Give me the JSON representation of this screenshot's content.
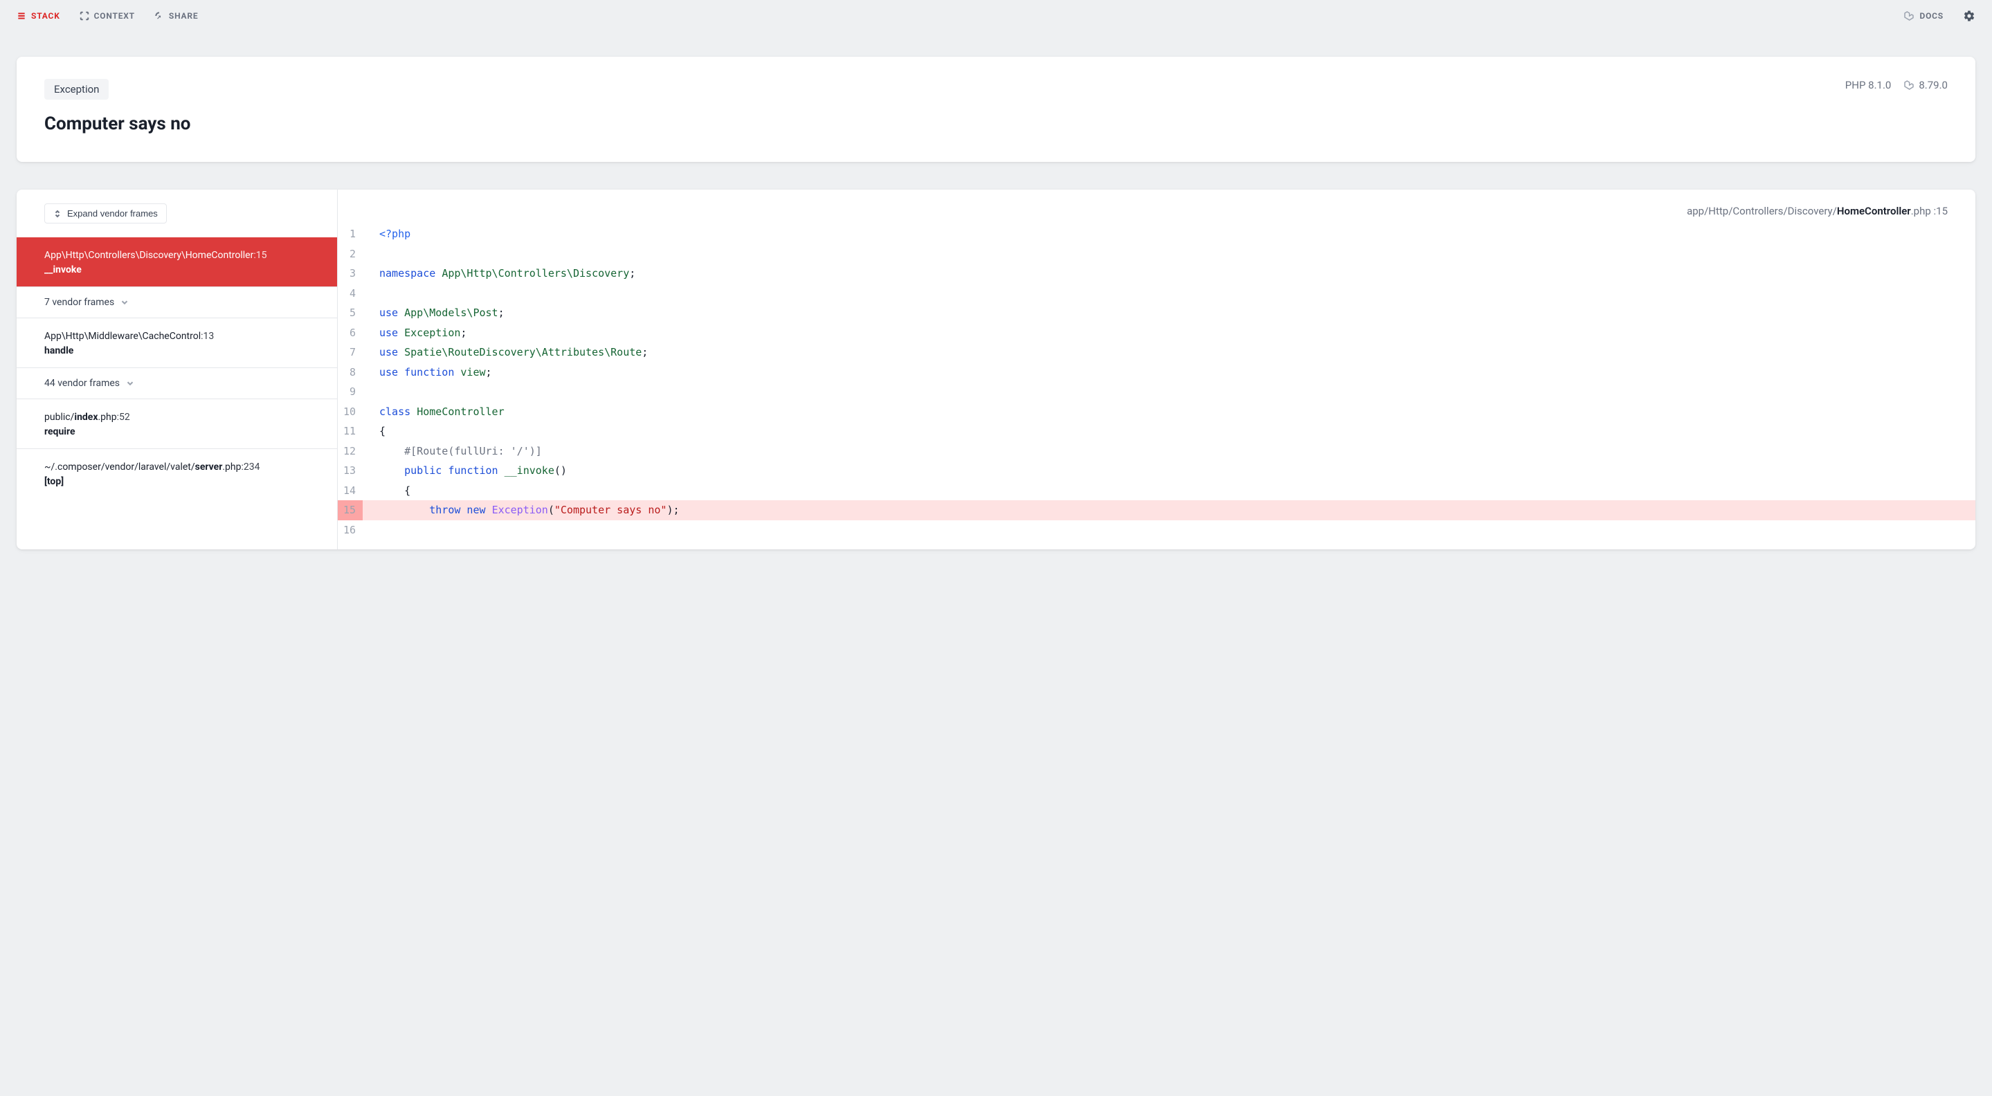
{
  "nav": {
    "stack": "STACK",
    "context": "CONTEXT",
    "share": "SHARE",
    "docs": "DOCS"
  },
  "header": {
    "badge": "Exception",
    "title": "Computer says no",
    "php_version": "PHP 8.1.0",
    "framework_version": "8.79.0"
  },
  "sidebar": {
    "expand_label": "Expand vendor frames",
    "frames": [
      {
        "type": "active",
        "path": "App\\Http\\Controllers\\Discovery\\HomeController",
        "line": "15",
        "method": "__invoke"
      },
      {
        "type": "collapsed",
        "label": "7 vendor frames"
      },
      {
        "type": "frame",
        "path": "App\\Http\\Middleware\\CacheControl",
        "line": "13",
        "method": "handle"
      },
      {
        "type": "collapsed",
        "label": "44 vendor frames"
      },
      {
        "type": "frame",
        "path_pre": "public/",
        "path_bold": "index",
        "path_post": ".php",
        "line": "52",
        "method": "require"
      },
      {
        "type": "frame",
        "path_pre": "~/.composer/vendor/laravel/valet/",
        "path_bold": "server",
        "path_post": ".php",
        "line": "234",
        "method": "[top]"
      }
    ]
  },
  "file": {
    "segments": [
      "app",
      "Http",
      "Controllers",
      "Discovery"
    ],
    "name": "HomeController",
    "ext": ".php",
    "line": "15"
  },
  "code": {
    "highlight": 15,
    "lines": [
      {
        "n": 1,
        "tokens": [
          [
            "tag",
            "<?php"
          ]
        ]
      },
      {
        "n": 2,
        "tokens": []
      },
      {
        "n": 3,
        "tokens": [
          [
            "kw",
            "namespace "
          ],
          [
            "ns",
            "App\\Http\\Controllers\\Discovery"
          ],
          [
            "plain",
            ";"
          ]
        ]
      },
      {
        "n": 4,
        "tokens": []
      },
      {
        "n": 5,
        "tokens": [
          [
            "kw",
            "use "
          ],
          [
            "ns",
            "App\\Models\\Post"
          ],
          [
            "plain",
            ";"
          ]
        ]
      },
      {
        "n": 6,
        "tokens": [
          [
            "kw",
            "use "
          ],
          [
            "ns",
            "Exception"
          ],
          [
            "plain",
            ";"
          ]
        ]
      },
      {
        "n": 7,
        "tokens": [
          [
            "kw",
            "use "
          ],
          [
            "ns",
            "Spatie\\RouteDiscovery\\Attributes\\Route"
          ],
          [
            "plain",
            ";"
          ]
        ]
      },
      {
        "n": 8,
        "tokens": [
          [
            "kw",
            "use function "
          ],
          [
            "ns",
            "view"
          ],
          [
            "plain",
            ";"
          ]
        ]
      },
      {
        "n": 9,
        "tokens": []
      },
      {
        "n": 10,
        "tokens": [
          [
            "kw",
            "class "
          ],
          [
            "class",
            "HomeController"
          ]
        ]
      },
      {
        "n": 11,
        "tokens": [
          [
            "plain",
            "{"
          ]
        ]
      },
      {
        "n": 12,
        "tokens": [
          [
            "plain",
            "    "
          ],
          [
            "comment",
            "#[Route(fullUri: '/')]"
          ]
        ]
      },
      {
        "n": 13,
        "tokens": [
          [
            "plain",
            "    "
          ],
          [
            "kw",
            "public function "
          ],
          [
            "fn",
            "__invoke"
          ],
          [
            "plain",
            "()"
          ]
        ]
      },
      {
        "n": 14,
        "tokens": [
          [
            "plain",
            "    {"
          ]
        ]
      },
      {
        "n": 15,
        "tokens": [
          [
            "plain",
            "        "
          ],
          [
            "kw",
            "throw new "
          ],
          [
            "fncall",
            "Exception"
          ],
          [
            "plain",
            "("
          ],
          [
            "str",
            "\"Computer says no\""
          ],
          [
            "plain",
            ");"
          ]
        ]
      },
      {
        "n": 16,
        "tokens": []
      }
    ]
  }
}
